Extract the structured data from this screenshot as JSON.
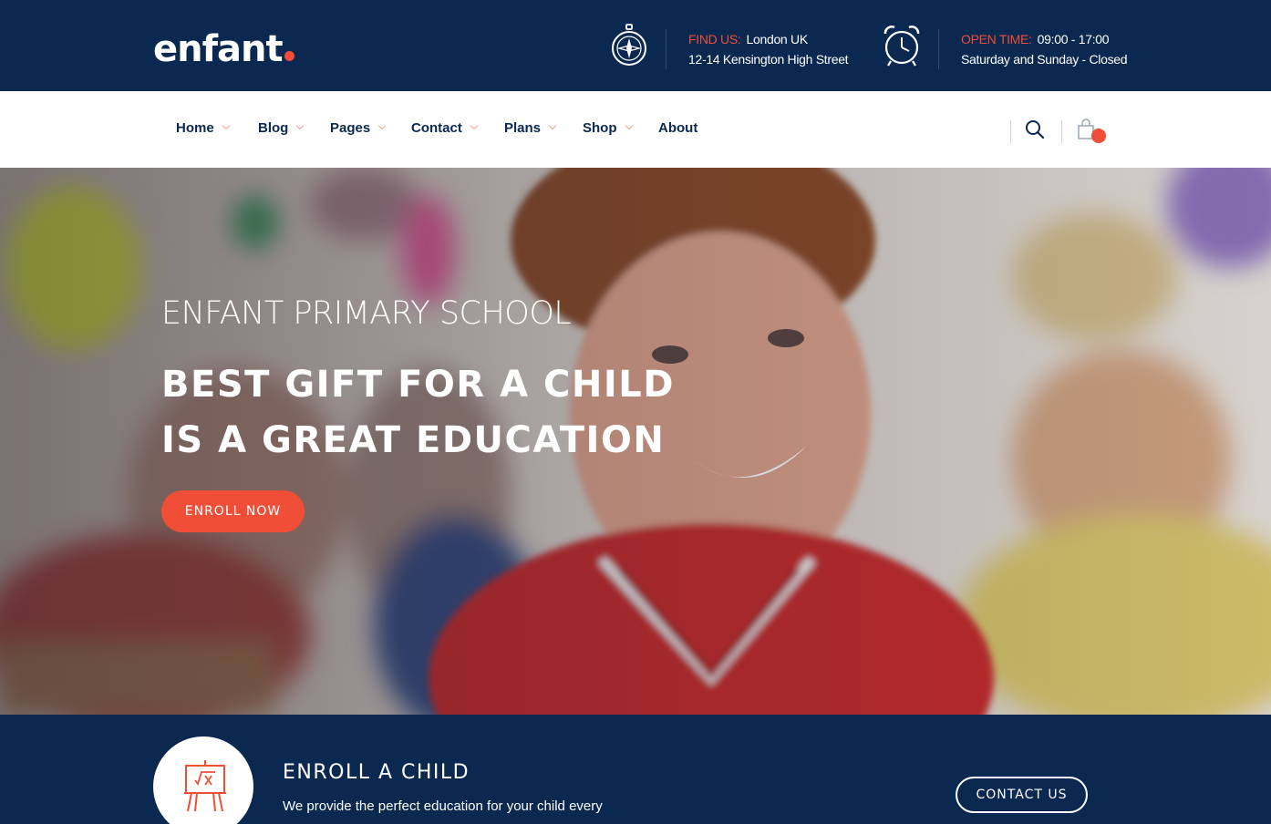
{
  "brand": {
    "logo_text": "enfant",
    "accent_color": "#f04e37",
    "navy_color": "#0a2850"
  },
  "topbar": {
    "find_us": {
      "icon": "compass-icon",
      "label": "FIND US:",
      "line1": "London UK",
      "line2": "12-14 Kensington High Street"
    },
    "open_time": {
      "icon": "alarm-clock-icon",
      "label": "OPEN TIME:",
      "line1": "09:00 - 17:00",
      "line2": "Saturday and Sunday - Closed"
    }
  },
  "nav": {
    "items": [
      {
        "label": "Home"
      },
      {
        "label": "Blog"
      },
      {
        "label": "Pages"
      },
      {
        "label": "Contact"
      },
      {
        "label": "Plans"
      },
      {
        "label": "Shop"
      },
      {
        "label": "About"
      }
    ],
    "search_icon": "search-icon",
    "cart_icon": "shopping-bag-icon"
  },
  "hero": {
    "subtitle": "ENFANT PRIMARY SCHOOL",
    "title_line1": "BEST GIFT FOR A CHILD",
    "title_line2": "IS A GREAT EDUCATION",
    "button_label": "ENROLL NOW"
  },
  "enroll": {
    "icon": "easel-math-icon",
    "title": "ENROLL A CHILD",
    "description": "We provide the perfect education for your child every",
    "button_label": "CONTACT US"
  }
}
